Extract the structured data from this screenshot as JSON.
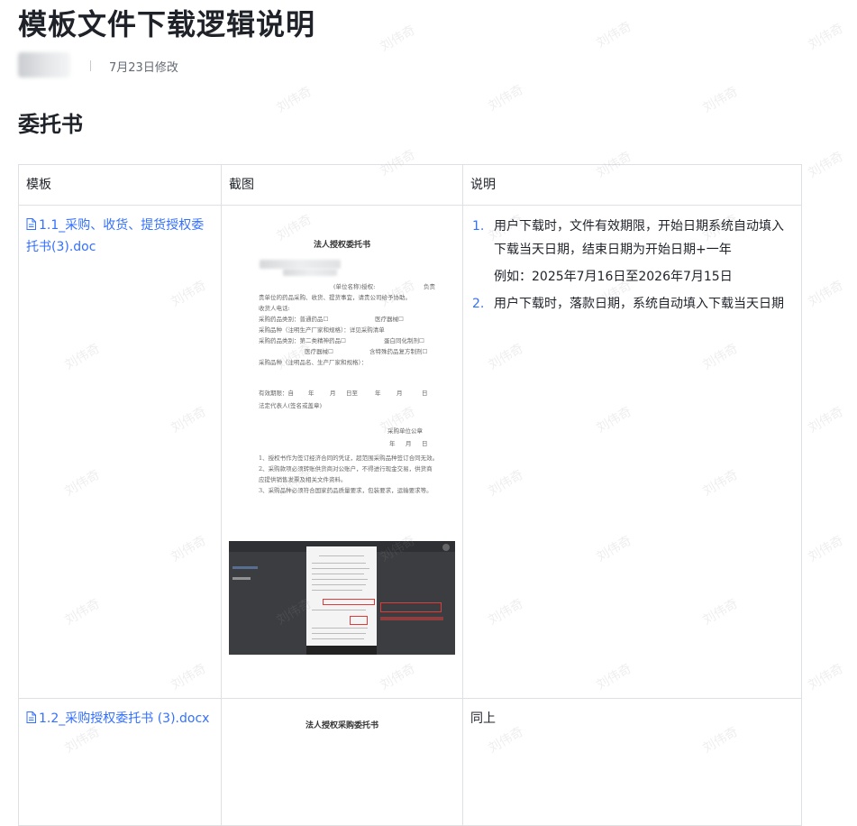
{
  "title": "模板文件下载逻辑说明",
  "meta": {
    "modified": "7月23日修改"
  },
  "section": {
    "title": "委托书"
  },
  "watermark": "刘伟奇",
  "table": {
    "headers": [
      "模板",
      "截图",
      "说明"
    ],
    "rows": [
      {
        "file": "1.1_采购、收货、提货授权委托书(3).doc",
        "preview": {
          "title": "法人授权委托书",
          "lines": [
            "(单位名称)授权:",
            "负责",
            "贵单位的药品采购、收货、提货事宜，请贵公司给予协助。",
            "收货人电话:",
            "采购药品类别：普通药品☐",
            "医疗器械☐",
            "采购品种（注明生产厂家和规格）：详见采购清单",
            "采购药品类别：第二类精神药品☐",
            "蛋白同化制剂☐",
            "医疗器械☐",
            "含特殊药品复方制剂☐",
            "采购品种（注明品名、生产厂家和规格）：",
            "有效期限：自",
            "年",
            "月",
            "日至",
            "年",
            "月",
            "日",
            "法定代表人(签名或盖章)",
            "采购单位公章",
            "年",
            "月",
            "日",
            "1、授权书作为签订经济合同的凭证，超范围采购品种签订合同无效。",
            "2、采购款项必须转账供货商对公账户，不得进行现金交易，供货商",
            "应提供销售发票及相关文件资料。",
            "3、采购品种必须符合国家药品质量要求，包装要求，运输要求等。"
          ]
        },
        "notes": [
          {
            "num": "1.",
            "text": "用户下载时，文件有效期限，开始日期系统自动填入下载当天日期，结束日期为开始日期+一年"
          },
          {
            "num": "2.",
            "text": "用户下载时，落款日期，系统自动填入下载当天日期"
          }
        ],
        "example": "例如：2025年7月16日至2026年7月15日"
      },
      {
        "file": "1.2_采购授权委托书 (3).docx",
        "preview": {
          "title": "法人授权采购委托书"
        },
        "desc": "同上"
      }
    ]
  },
  "colors": {
    "link": "#3370ff",
    "border": "#dee0e3",
    "text": "#1f2329",
    "muted": "#646a73"
  },
  "icons": {
    "file": "file-doc-icon",
    "avatar": "user-avatar"
  }
}
